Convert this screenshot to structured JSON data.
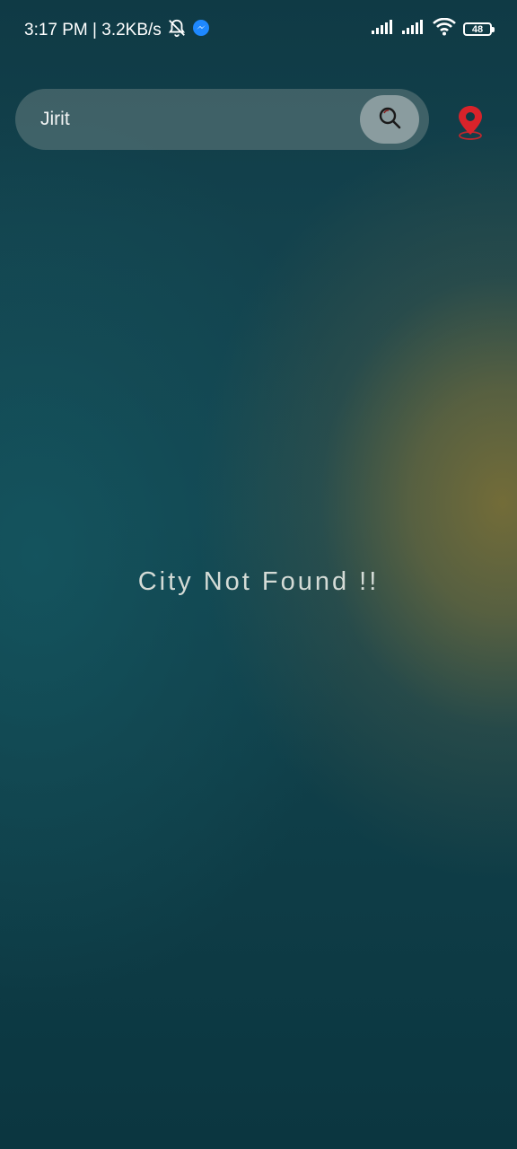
{
  "status_bar": {
    "time_speed": "3:17 PM | 3.2KB/s",
    "battery": "48",
    "icons": [
      "notifications-off-icon",
      "messenger-icon",
      "signal-icon",
      "signal-icon",
      "wifi-icon",
      "battery-icon"
    ]
  },
  "search": {
    "value": "Jirit",
    "button_icon": "search-icon"
  },
  "location_icon": "location-pin-icon",
  "message": "City Not Found !!",
  "colors": {
    "pin_red": "#d8232a",
    "messenger_blue": "#1e88ff"
  }
}
